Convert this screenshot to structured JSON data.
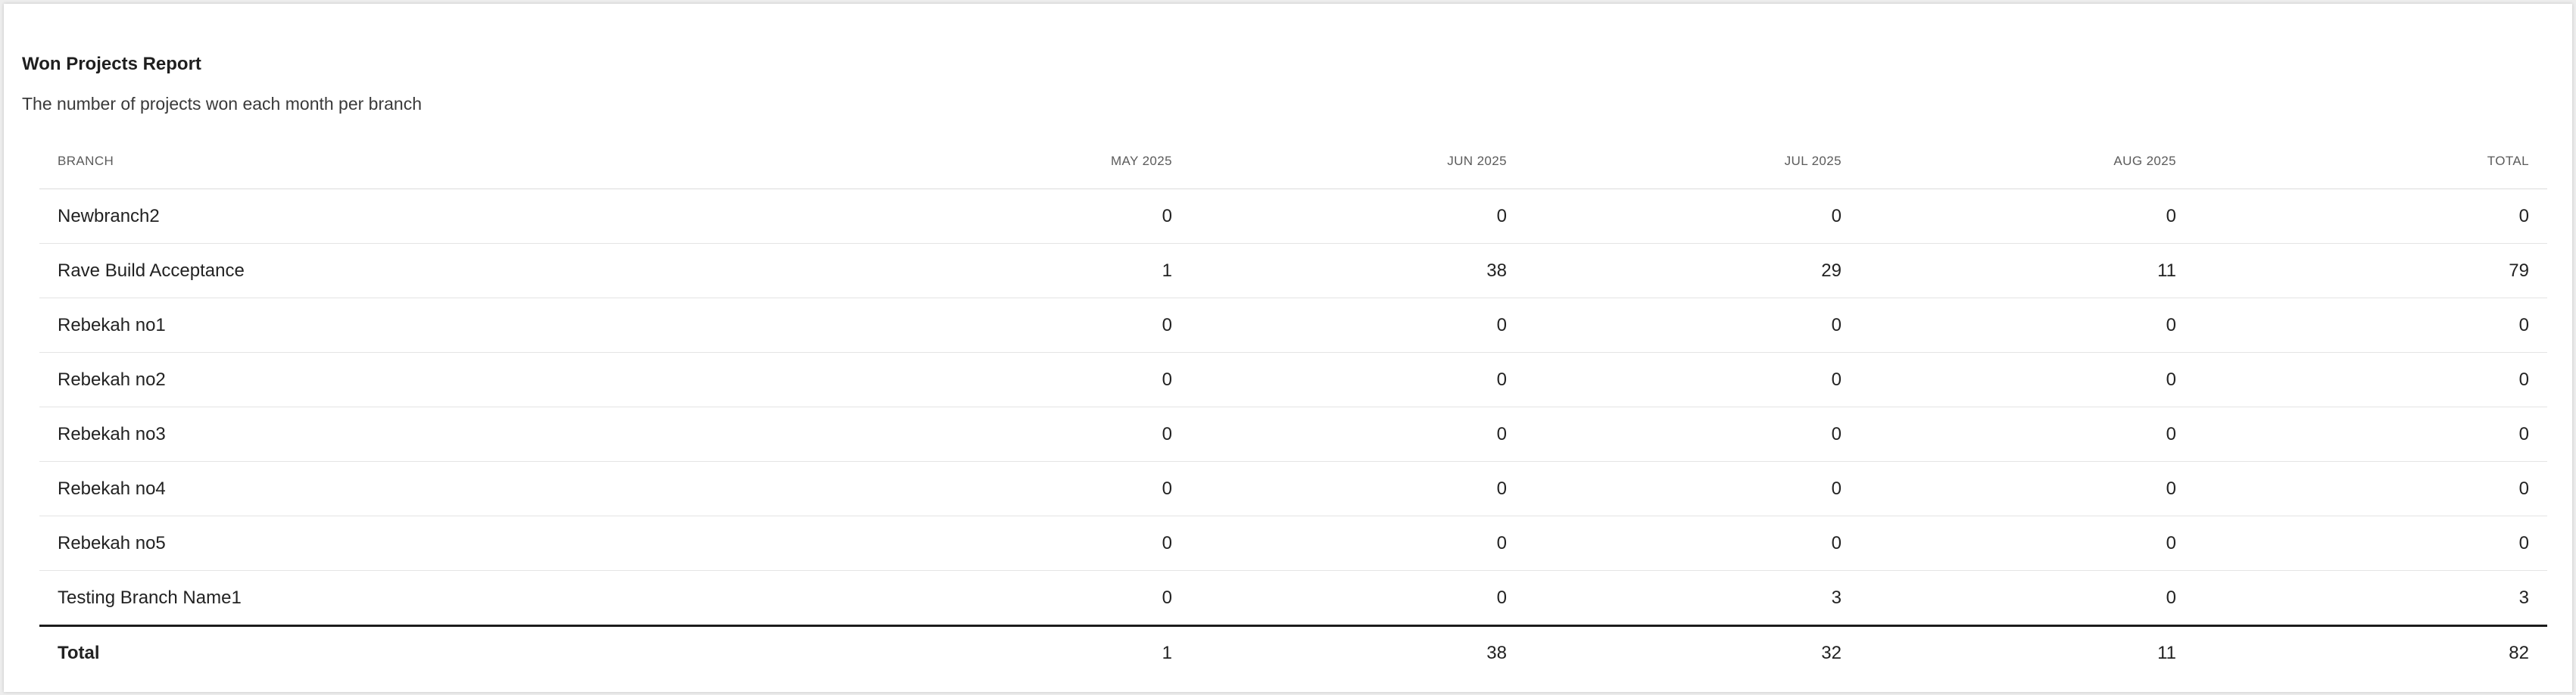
{
  "report": {
    "title": "Won Projects Report",
    "subtitle": "The number of projects won each month per branch"
  },
  "table": {
    "headers": {
      "branch": "BRANCH",
      "may": "MAY 2025",
      "jun": "JUN 2025",
      "jul": "JUL 2025",
      "aug": "AUG 2025",
      "total": "TOTAL"
    },
    "rows": [
      {
        "branch": "Newbranch2",
        "may": "0",
        "jun": "0",
        "jul": "0",
        "aug": "0",
        "total": "0"
      },
      {
        "branch": "Rave Build Acceptance",
        "may": "1",
        "jun": "38",
        "jul": "29",
        "aug": "11",
        "total": "79"
      },
      {
        "branch": "Rebekah no1",
        "may": "0",
        "jun": "0",
        "jul": "0",
        "aug": "0",
        "total": "0"
      },
      {
        "branch": "Rebekah no2",
        "may": "0",
        "jun": "0",
        "jul": "0",
        "aug": "0",
        "total": "0"
      },
      {
        "branch": "Rebekah no3",
        "may": "0",
        "jun": "0",
        "jul": "0",
        "aug": "0",
        "total": "0"
      },
      {
        "branch": "Rebekah no4",
        "may": "0",
        "jun": "0",
        "jul": "0",
        "aug": "0",
        "total": "0"
      },
      {
        "branch": "Rebekah no5",
        "may": "0",
        "jun": "0",
        "jul": "0",
        "aug": "0",
        "total": "0"
      },
      {
        "branch": "Testing Branch Name1",
        "may": "0",
        "jun": "0",
        "jul": "3",
        "aug": "0",
        "total": "3"
      }
    ],
    "totals": {
      "branch": "Total",
      "may": "1",
      "jun": "38",
      "jul": "32",
      "aug": "11",
      "total": "82"
    }
  }
}
